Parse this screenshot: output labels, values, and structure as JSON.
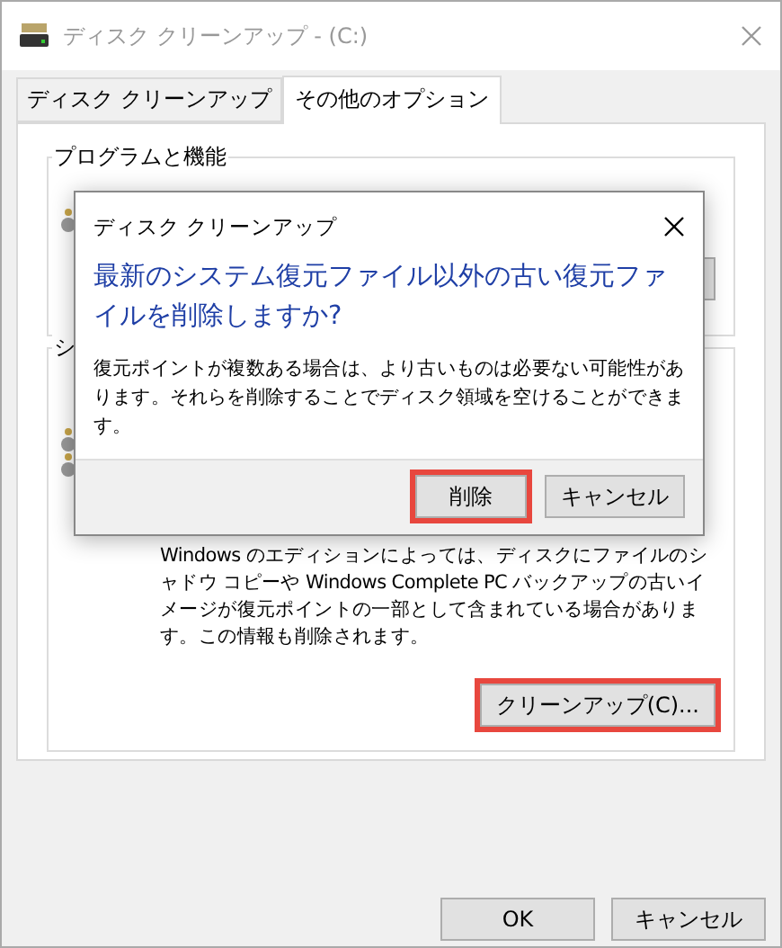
{
  "window": {
    "title": "ディスク クリーンアップ - (C:)"
  },
  "tabs": [
    {
      "label": "ディスク クリーンアップ",
      "selected": false
    },
    {
      "label": "その他のオプション",
      "selected": true
    }
  ],
  "groups": [
    {
      "title": "プログラムと機能"
    },
    {
      "title": "シ",
      "description": "Windows のエディションによっては、ディスクにファイルのシャドウ コピーや Windows Complete PC バックアップの古いイメージが復元ポイントの一部として含まれている場合があります。この情報も削除されます。",
      "button": {
        "label": "クリーンアップ(C)...",
        "highlighted": true
      }
    }
  ],
  "buttons": [
    {
      "label": "OK",
      "highlighted": false
    },
    {
      "label": "キャンセル",
      "highlighted": false
    }
  ],
  "dialog": {
    "title": "ディスク クリーンアップ",
    "heading": "最新のシステム復元ファイル以外の古い復元ファイルを削除しますか?",
    "message": "復元ポイントが複数ある場合は、より古いものは必要ない可能性があります。それらを削除することでディスク領域を空けることができます。",
    "buttons": [
      {
        "label": "削除",
        "highlighted": true
      },
      {
        "label": "キャンセル",
        "highlighted": false
      }
    ]
  }
}
